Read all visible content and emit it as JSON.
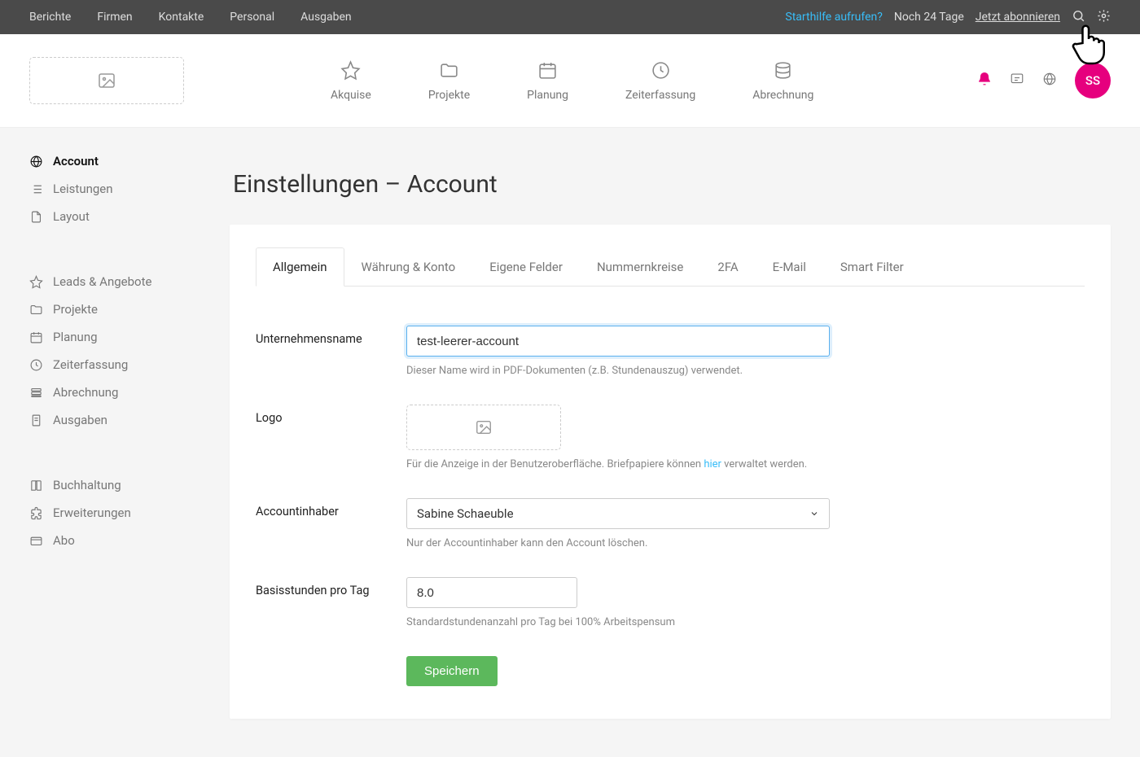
{
  "topbar": {
    "links": [
      "Berichte",
      "Firmen",
      "Kontakte",
      "Personal",
      "Ausgaben"
    ],
    "start_help": "Starthilfe aufrufen?",
    "trial": "Noch 24 Tage",
    "subscribe": "Jetzt abonnieren"
  },
  "header": {
    "nav": [
      {
        "label": "Akquise",
        "icon": "star"
      },
      {
        "label": "Projekte",
        "icon": "folder"
      },
      {
        "label": "Planung",
        "icon": "calendar"
      },
      {
        "label": "Zeiterfassung",
        "icon": "clock"
      },
      {
        "label": "Abrechnung",
        "icon": "database"
      }
    ],
    "avatar": "SS"
  },
  "page_title": "Einstellungen – Account",
  "sidebar": {
    "groups": [
      [
        {
          "label": "Account",
          "icon": "globe",
          "active": true
        },
        {
          "label": "Leistungen",
          "icon": "list"
        },
        {
          "label": "Layout",
          "icon": "file"
        }
      ],
      [
        {
          "label": "Leads & Angebote",
          "icon": "star"
        },
        {
          "label": "Projekte",
          "icon": "folder"
        },
        {
          "label": "Planung",
          "icon": "calendar"
        },
        {
          "label": "Zeiterfassung",
          "icon": "clock"
        },
        {
          "label": "Abrechnung",
          "icon": "stack"
        },
        {
          "label": "Ausgaben",
          "icon": "receipt"
        }
      ],
      [
        {
          "label": "Buchhaltung",
          "icon": "book"
        },
        {
          "label": "Erweiterungen",
          "icon": "puzzle"
        },
        {
          "label": "Abo",
          "icon": "card"
        }
      ]
    ]
  },
  "tabs": [
    "Allgemein",
    "Währung & Konto",
    "Eigene Felder",
    "Nummernkreise",
    "2FA",
    "E-Mail",
    "Smart Filter"
  ],
  "form": {
    "company": {
      "label": "Unternehmensname",
      "value": "test-leerer-account",
      "help": "Dieser Name wird in PDF-Dokumenten (z.B. Stundenauszug) verwendet."
    },
    "logo": {
      "label": "Logo",
      "help_pre": "Für die Anzeige in der Benutzeroberfläche. Briefpapiere können ",
      "help_link": "hier",
      "help_post": " verwaltet werden."
    },
    "owner": {
      "label": "Accountinhaber",
      "value": "Sabine Schaeuble",
      "help": "Nur der Accountinhaber kann den Account löschen."
    },
    "hours": {
      "label": "Basisstunden pro Tag",
      "value": "8.0",
      "help": "Standardstundenanzahl pro Tag bei 100% Arbeitspensum"
    },
    "save": "Speichern"
  }
}
